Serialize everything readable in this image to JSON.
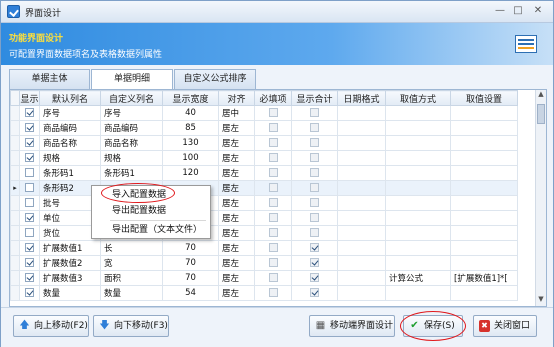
{
  "window": {
    "title": "界面设计"
  },
  "header": {
    "title": "功能界面设计",
    "subtitle": "可配置界面数据项名及表格数据列属性"
  },
  "tabs": [
    {
      "label": "单据主体"
    },
    {
      "label": "单据明细"
    },
    {
      "label": "自定义公式排序"
    }
  ],
  "grid": {
    "columns": [
      "显示",
      "默认列名",
      "自定义列名",
      "显示宽度",
      "对齐",
      "必填项",
      "显示合计",
      "日期格式",
      "取值方式",
      "取值设置"
    ],
    "rows": [
      {
        "show": true,
        "name": "序号",
        "custom": "序号",
        "width": "40",
        "align": "居中",
        "required": false,
        "sum": false,
        "date": "",
        "mode": "",
        "set": ""
      },
      {
        "show": true,
        "name": "商品编码",
        "custom": "商品编码",
        "width": "85",
        "align": "居左",
        "required": false,
        "sum": false,
        "date": "",
        "mode": "",
        "set": ""
      },
      {
        "show": true,
        "name": "商品名称",
        "custom": "商品名称",
        "width": "130",
        "align": "居左",
        "required": false,
        "sum": false,
        "date": "",
        "mode": "",
        "set": ""
      },
      {
        "show": true,
        "name": "规格",
        "custom": "规格",
        "width": "100",
        "align": "居左",
        "required": false,
        "sum": false,
        "date": "",
        "mode": "",
        "set": ""
      },
      {
        "show": false,
        "name": "条形码1",
        "custom": "条形码1",
        "width": "120",
        "align": "居左",
        "required": false,
        "sum": false,
        "date": "",
        "mode": "",
        "set": ""
      },
      {
        "show": false,
        "name": "条形码2",
        "custom": "",
        "width": "",
        "align": "居左",
        "required": false,
        "sum": false,
        "date": "",
        "mode": "",
        "set": ""
      },
      {
        "show": false,
        "name": "批号",
        "custom": "",
        "width": "",
        "align": "居左",
        "required": false,
        "sum": false,
        "date": "",
        "mode": "",
        "set": ""
      },
      {
        "show": true,
        "name": "单位",
        "custom": "",
        "width": "",
        "align": "居左",
        "required": false,
        "sum": false,
        "date": "",
        "mode": "",
        "set": ""
      },
      {
        "show": false,
        "name": "货位",
        "custom": "货位",
        "width": "",
        "align": "居左",
        "required": false,
        "sum": false,
        "date": "",
        "mode": "",
        "set": ""
      },
      {
        "show": true,
        "name": "扩展数值1",
        "custom": "长",
        "width": "70",
        "align": "居左",
        "required": false,
        "sum": true,
        "date": "",
        "mode": "",
        "set": ""
      },
      {
        "show": true,
        "name": "扩展数值2",
        "custom": "宽",
        "width": "70",
        "align": "居左",
        "required": false,
        "sum": true,
        "date": "",
        "mode": "",
        "set": ""
      },
      {
        "show": true,
        "name": "扩展数值3",
        "custom": "面积",
        "width": "70",
        "align": "居左",
        "required": false,
        "sum": true,
        "date": "",
        "mode": "计算公式",
        "set": "[扩展数值1]*["
      },
      {
        "show": true,
        "name": "数量",
        "custom": "数量",
        "width": "54",
        "align": "居左",
        "required": false,
        "sum": true,
        "date": "",
        "mode": "",
        "set": ""
      }
    ]
  },
  "context_menu": {
    "items": [
      "导入配置数据",
      "导出配置数据",
      "导出配置（文本文件）"
    ]
  },
  "footer": {
    "move_up": "向上移动(F2)",
    "move_down": "向下移动(F3)",
    "mobile_design": "移动端界面设计",
    "save": "保存(S)",
    "close": "关闭窗口"
  },
  "icons": {
    "app": "window-check-icon",
    "header": "form-config-icon",
    "save": "check-icon",
    "close": "close-icon",
    "up": "arrow-up-icon",
    "down": "arrow-down-icon"
  },
  "colors": {
    "header_bg": "#2f8be0",
    "header_title": "#ffe03a",
    "highlight": "#e0191d"
  }
}
